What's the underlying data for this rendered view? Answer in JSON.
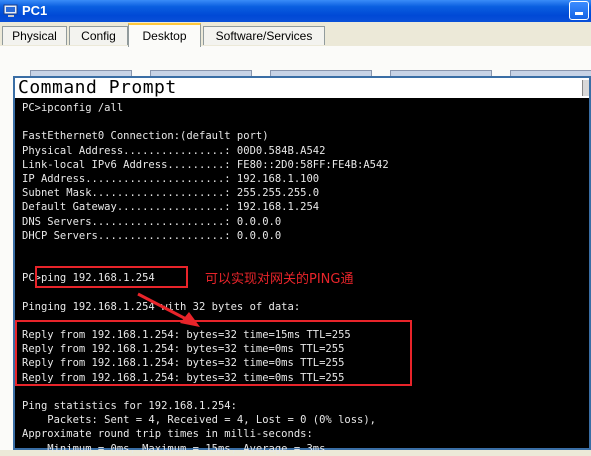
{
  "window": {
    "title": "PC1"
  },
  "tabs": [
    {
      "label": "Physical"
    },
    {
      "label": "Config"
    },
    {
      "label": "Desktop"
    },
    {
      "label": "Software/Services"
    }
  ],
  "command_prompt": {
    "title": "Command Prompt",
    "lines": [
      "PC>ipconfig /all",
      "",
      "FastEthernet0 Connection:(default port)",
      "Physical Address................: 00D0.584B.A542",
      "Link-local IPv6 Address.........: FE80::2D0:58FF:FE4B:A542",
      "IP Address......................: 192.168.1.100",
      "Subnet Mask.....................: 255.255.255.0",
      "Default Gateway.................: 192.168.1.254",
      "DNS Servers.....................: 0.0.0.0",
      "DHCP Servers....................: 0.0.0.0",
      "",
      "",
      "PC>ping 192.168.1.254",
      "",
      "Pinging 192.168.1.254 with 32 bytes of data:",
      "",
      "Reply from 192.168.1.254: bytes=32 time=15ms TTL=255",
      "Reply from 192.168.1.254: bytes=32 time=0ms TTL=255",
      "Reply from 192.168.1.254: bytes=32 time=0ms TTL=255",
      "Reply from 192.168.1.254: bytes=32 time=0ms TTL=255",
      "",
      "Ping statistics for 192.168.1.254:",
      "    Packets: Sent = 4, Received = 4, Lost = 0 (0% loss),",
      "Approximate round trip times in milli-seconds:",
      "    Minimum = 0ms, Maximum = 15ms, Average = 3ms"
    ]
  },
  "annotation": {
    "text": "可以实现对网关的PING通"
  },
  "colors": {
    "annotation_red": "#e8242a",
    "titlebar_blue": "#0a5fe0"
  }
}
